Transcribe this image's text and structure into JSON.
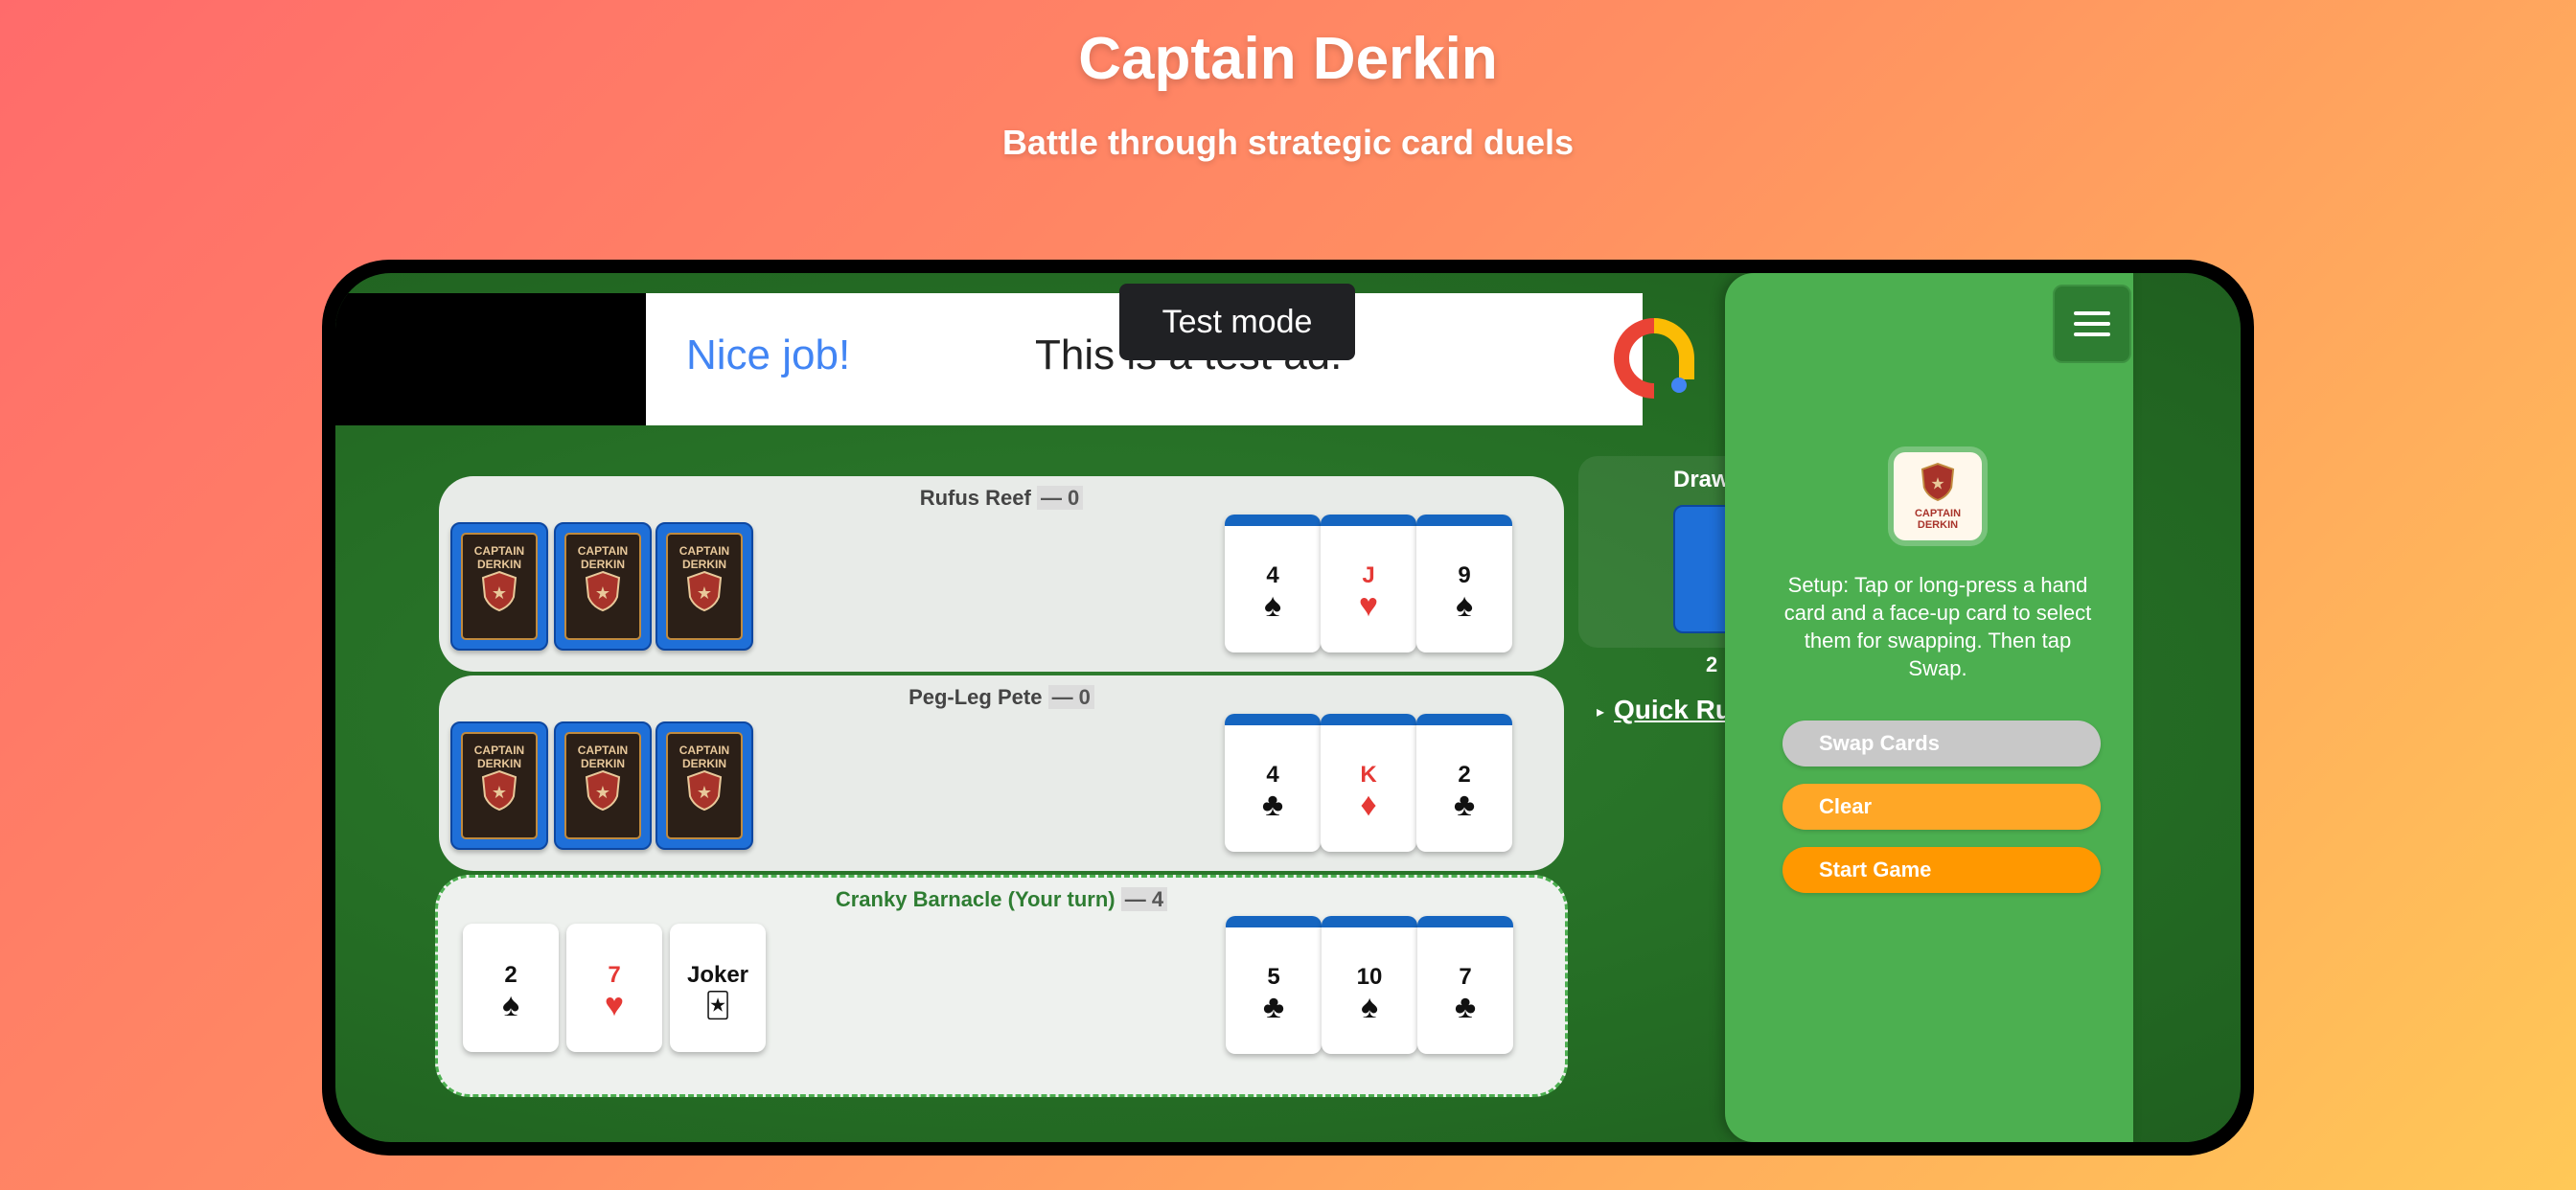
{
  "header": {
    "title": "Captain Derkin",
    "subtitle": "Battle through strategic card duels"
  },
  "ad": {
    "headline": "Nice job!",
    "body": "This is a test ad.",
    "badge": "Test mode"
  },
  "players": [
    {
      "name": "Rufus Reef",
      "score": "— 0",
      "hand_backs": [
        "CAPTAIN DERKIN",
        "CAPTAIN DERKIN",
        "CAPTAIN DERKIN"
      ],
      "face_up": [
        {
          "rank": "4",
          "suit": "♠",
          "color": "black"
        },
        {
          "rank": "J",
          "suit": "♥",
          "color": "red"
        },
        {
          "rank": "9",
          "suit": "♠",
          "color": "black"
        }
      ]
    },
    {
      "name": "Peg-Leg Pete",
      "score": "— 0",
      "hand_backs": [
        "CAPTAIN DERKIN",
        "CAPTAIN DERKIN",
        "CAPTAIN DERKIN"
      ],
      "face_up": [
        {
          "rank": "4",
          "suit": "♣",
          "color": "black"
        },
        {
          "rank": "K",
          "suit": "♦",
          "color": "red"
        },
        {
          "rank": "2",
          "suit": "♣",
          "color": "black"
        }
      ]
    },
    {
      "name": "Cranky Barnacle (Your turn)",
      "score": "— 4",
      "hand": [
        {
          "rank": "2",
          "suit": "♠",
          "color": "black"
        },
        {
          "rank": "7",
          "suit": "♥",
          "color": "red"
        },
        {
          "rank": "Joker",
          "suit": "🃏",
          "color": "black"
        }
      ],
      "face_up": [
        {
          "rank": "5",
          "suit": "♣",
          "color": "black"
        },
        {
          "rank": "10",
          "suit": "♠",
          "color": "black"
        },
        {
          "rank": "7",
          "suit": "♣",
          "color": "black"
        }
      ]
    }
  ],
  "draw_pile": {
    "label": "Draw Pile",
    "count": "2",
    "quick_rules": "Quick Rules"
  },
  "menu": {
    "logo_text": "CAPTAIN DERKIN",
    "instructions": "Setup: Tap or long-press a hand card and a face-up card to select them for swapping. Then tap Swap.",
    "swap_label": "Swap Cards",
    "clear_label": "Clear",
    "start_label": "Start Game"
  },
  "colors": {
    "felt": "#256e25",
    "menu_bg": "#4caf50",
    "card_back": "#1e6fd8",
    "accent_orange": "#ff9800",
    "red_suit": "#e53935"
  }
}
